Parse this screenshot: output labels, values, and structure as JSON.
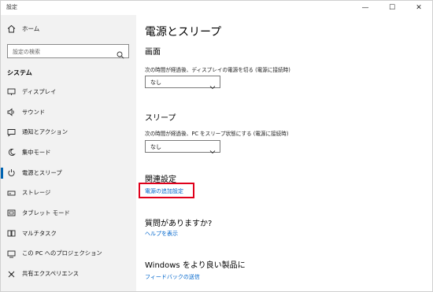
{
  "window": {
    "title": "設定",
    "controls": {
      "minimize": "—",
      "maximize": "☐",
      "close": "✕"
    }
  },
  "sidebar": {
    "home_label": "ホーム",
    "search_placeholder": "設定の検索",
    "section_label": "システム",
    "items": [
      {
        "label": "ディスプレイ",
        "icon": "display-icon"
      },
      {
        "label": "サウンド",
        "icon": "speaker-icon"
      },
      {
        "label": "通知とアクション",
        "icon": "notification-icon"
      },
      {
        "label": "集中モード",
        "icon": "moon-icon"
      },
      {
        "label": "電源とスリープ",
        "icon": "power-icon",
        "selected": true
      },
      {
        "label": "ストレージ",
        "icon": "storage-icon"
      },
      {
        "label": "タブレット モード",
        "icon": "tablet-icon"
      },
      {
        "label": "マルチタスク",
        "icon": "multitask-icon"
      },
      {
        "label": "この PC へのプロジェクション",
        "icon": "projection-icon"
      },
      {
        "label": "共有エクスペリエンス",
        "icon": "shared-experience-icon"
      }
    ]
  },
  "main": {
    "title": "電源とスリープ",
    "screen": {
      "heading": "画面",
      "description": "次の時間が経過後、ディスプレイの電源を切る (電源に接続時)",
      "value": "なし"
    },
    "sleep": {
      "heading": "スリープ",
      "description": "次の時間が経過後、PC をスリープ状態にする (電源に接続時)",
      "value": "なし"
    },
    "related": {
      "heading": "関連設定",
      "link": "電源の追加設定"
    },
    "questions": {
      "heading": "質問がありますか?",
      "link": "ヘルプを表示"
    },
    "improve": {
      "heading": "Windows をより良い製品に",
      "link": "フィードバックの送信"
    }
  },
  "colors": {
    "accent": "#0063b1",
    "link": "#0066cc",
    "highlight": "#e0001b",
    "sidebar_bg": "#f2f2f2"
  }
}
